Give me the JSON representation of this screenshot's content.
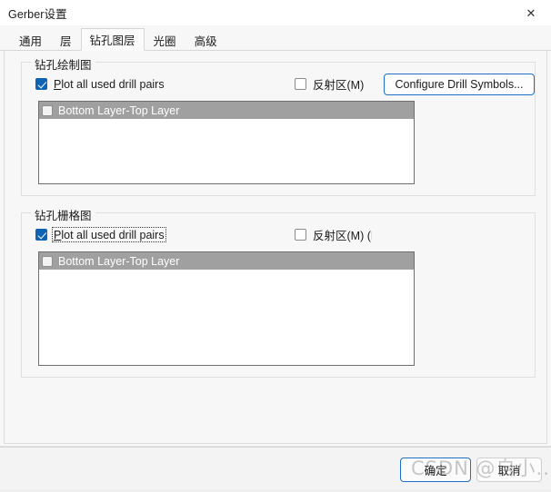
{
  "window": {
    "title": "Gerber设置",
    "close_icon": "close-icon",
    "close_glyph": "✕"
  },
  "tabs": [
    {
      "label": "通用",
      "selected": false
    },
    {
      "label": "层",
      "selected": false
    },
    {
      "label": "钻孔图层",
      "selected": true
    },
    {
      "label": "光圈",
      "selected": false
    },
    {
      "label": "高级",
      "selected": false
    }
  ],
  "groups": {
    "drill_drawing": {
      "legend": "钻孔绘制图",
      "plot_all_checkbox": {
        "accel": "P",
        "rest": "lot all used drill pairs",
        "checked": true,
        "focused": false
      },
      "mirror_checkbox": {
        "label": "反射区(M)",
        "checked": false
      },
      "configure_button": "Configure Drill Symbols...",
      "list_items": [
        {
          "label": "Bottom Layer-Top Layer",
          "checked": false,
          "selected": true
        }
      ]
    },
    "drill_grid": {
      "legend": "钻孔栅格图",
      "plot_all_checkbox": {
        "accel": "P",
        "rest": "lot all used drill pairs",
        "checked": true,
        "focused": true
      },
      "mirror_checkbox": {
        "label": "反射区(M) (M",
        "checked": false
      },
      "list_items": [
        {
          "label": "Bottom Layer-Top Layer",
          "checked": false,
          "selected": true
        }
      ]
    }
  },
  "footer": {
    "ok_label": "确定",
    "cancel_label": "取消"
  },
  "watermark": {
    "text": "CSDN @自小..多"
  },
  "colors": {
    "accent_blue": "#0f62b4",
    "focus_border": "#1f6fc4",
    "list_selected_disabled": "#a0a0a0",
    "window_bg": "#f7f7f7",
    "titlebar_bg": "#ffffff"
  }
}
